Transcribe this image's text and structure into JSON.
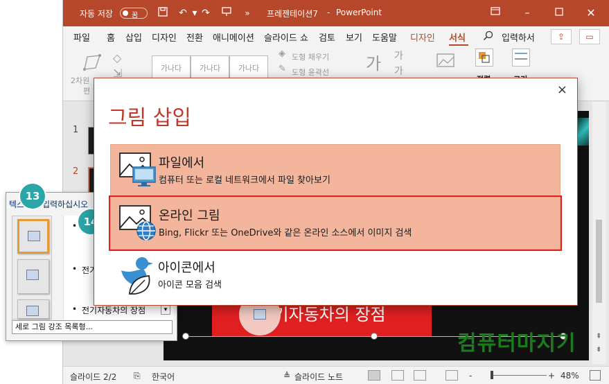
{
  "titlebar": {
    "autosave_label": "자동 저장",
    "autosave_state": "꿈",
    "doc_title": "프레젠테이션7",
    "separator": "-",
    "app_name": "PowerPoint"
  },
  "ribbon_tabs": [
    {
      "label": "파일"
    },
    {
      "label": "홈"
    },
    {
      "label": "삽입"
    },
    {
      "label": "디자인"
    },
    {
      "label": "전환"
    },
    {
      "label": "애니메이션"
    },
    {
      "label": "슬라이드 쇼"
    },
    {
      "label": "검토"
    },
    {
      "label": "보기"
    },
    {
      "label": "도움말"
    },
    {
      "label": "디자인"
    },
    {
      "label": "서식"
    }
  ],
  "search_label": "입력하서",
  "ribbon": {
    "shape_style_sample": "가나다",
    "fill_label": "도형 채우기",
    "outline_label": "도형 윤곽선",
    "left_group_label_1": "2차원",
    "left_group_label_2": "편",
    "align_label": "정렬",
    "size_label": "크기",
    "wordart_sample": "가"
  },
  "thumbs": [
    {
      "num": "1"
    },
    {
      "num": "2"
    }
  ],
  "textpane": {
    "title": "텍스트를 입력하십시오",
    "bullets": [
      "전기자동차의 장점"
    ],
    "bullet_partial": "전기",
    "footer": "세로 그림 강조 목록형..."
  },
  "callouts": {
    "a": "13",
    "b": "14"
  },
  "dialog": {
    "title": "그림 삽입",
    "close": "×",
    "options": [
      {
        "name": "파일에서",
        "desc": "컴퓨터 또는 로컬 네트워크에서 파일 찾아보기",
        "icon": "picture-computer-icon"
      },
      {
        "name": "온라인 그림",
        "desc": "Bing, Flickr 또는 OneDrive와 같은 온라인 소스에서 이미지 검색",
        "icon": "picture-globe-icon"
      },
      {
        "name": "아이콘에서",
        "desc": "아이콘 모음 검색",
        "icon": "bird-leaf-icon"
      }
    ]
  },
  "slide": {
    "banner_text": "전기자동차의 장점",
    "watermark": "컴퓨터마지기"
  },
  "status": {
    "slide_info": "슬라이드 2/2",
    "language": "한국어",
    "notes": "슬라이드 노트",
    "zoom": "48%",
    "zoom_minus": "-",
    "zoom_plus": "+"
  },
  "colors": {
    "accent": "#b7472a",
    "dialog_highlight": "#f3b59b",
    "callout": "#2aa6a8",
    "selection": "#e0201b"
  }
}
